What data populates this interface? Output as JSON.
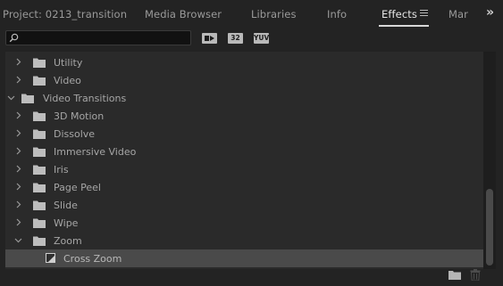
{
  "tabs": [
    {
      "label": "Project: 0213_transition",
      "active": false
    },
    {
      "label": "Media Browser",
      "active": false
    },
    {
      "label": "Libraries",
      "active": false
    },
    {
      "label": "Info",
      "active": false
    },
    {
      "label": "Effects",
      "active": true
    },
    {
      "label": "Mar",
      "active": false
    }
  ],
  "overflow_glyph": "»",
  "search": {
    "value": "",
    "placeholder": ""
  },
  "toolbar": {
    "accelerated_label": "",
    "bit_label": "32",
    "yuv_label": "YUV"
  },
  "tree": [
    {
      "label": "Utility",
      "kind": "folder",
      "expanded": false,
      "level": 1
    },
    {
      "label": "Video",
      "kind": "folder",
      "expanded": false,
      "level": 1
    },
    {
      "label": "Video Transitions",
      "kind": "folder",
      "expanded": true,
      "level": 0
    },
    {
      "label": "3D Motion",
      "kind": "folder",
      "expanded": false,
      "level": 1
    },
    {
      "label": "Dissolve",
      "kind": "folder",
      "expanded": false,
      "level": 1
    },
    {
      "label": "Immersive Video",
      "kind": "folder",
      "expanded": false,
      "level": 1
    },
    {
      "label": "Iris",
      "kind": "folder",
      "expanded": false,
      "level": 1
    },
    {
      "label": "Page Peel",
      "kind": "folder",
      "expanded": false,
      "level": 1
    },
    {
      "label": "Slide",
      "kind": "folder",
      "expanded": false,
      "level": 1
    },
    {
      "label": "Wipe",
      "kind": "folder",
      "expanded": false,
      "level": 1
    },
    {
      "label": "Zoom",
      "kind": "folder",
      "expanded": true,
      "level": 1
    },
    {
      "label": "Cross Zoom",
      "kind": "effect",
      "expanded": false,
      "level": 2,
      "selected": true
    }
  ],
  "colors": {
    "panel": "#232323",
    "list": "#2a2a2a",
    "selected_row": "#4a4a4a",
    "text": "#a6a6a6",
    "active_tab": "#e6e6e6"
  }
}
